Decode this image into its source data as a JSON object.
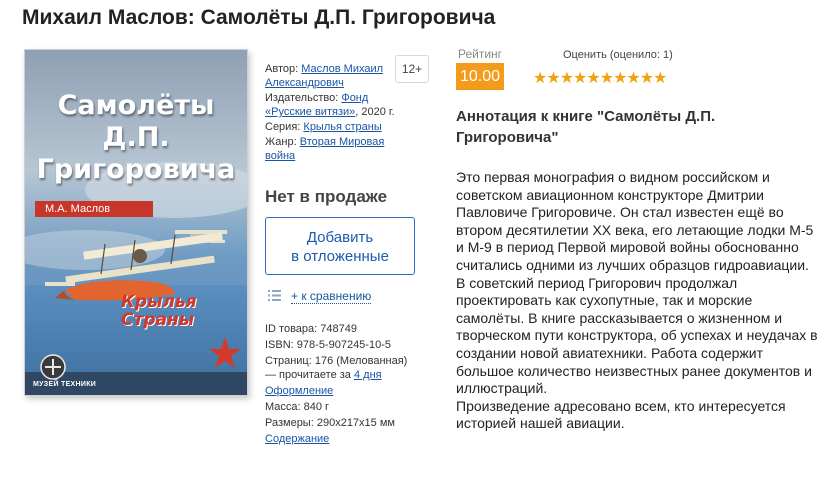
{
  "page_title": "Михаил Маслов: Самолёты Д.П. Григоровича",
  "cover": {
    "title_line1": "Самолёты",
    "title_line2": "Д.П. Григоровича",
    "author": "М.А. Маслов",
    "series_line1": "Крылья",
    "series_line2": "Страны",
    "publisher_mark": "МУЗЕЙ ТЕХНИКИ"
  },
  "age_rating": "12+",
  "meta": {
    "author_label": "Автор:",
    "author_value": "Маслов Михаил Александрович",
    "publisher_label": "Издательство:",
    "publisher_value": "Фонд «Русские витязи»",
    "publisher_year": ", 2020 г.",
    "series_label": "Серия:",
    "series_value": "Крылья страны",
    "genre_label": "Жанр:",
    "genre_value": "Вторая Мировая война"
  },
  "availability": "Нет в продаже",
  "add_button": {
    "line1": "Добавить",
    "line2": "в отложенные"
  },
  "compare_link": "+ к сравнению",
  "specs": {
    "id_label": "ID товара:",
    "id_value": "748749",
    "isbn_label": "ISBN:",
    "isbn_value": "978-5-907245-10-5",
    "pages_text": "Страниц: 176 (Мелованная)",
    "read_prefix": "— прочитаете за ",
    "read_link": "4 дня",
    "design_link": "Оформление",
    "weight_label": "Масса:",
    "weight_value": "840 г",
    "size_label": "Размеры:",
    "size_value": "290x217x15 мм",
    "contents_link": "Содержание"
  },
  "rating": {
    "label": "Рейтинг",
    "value": "10.00",
    "rated_text": "Оценить (оценило: 1)",
    "stars": "★★★★★★★★★★",
    "score": 10,
    "max": 10,
    "accent_color": "#f39b1a"
  },
  "annotation": {
    "title": "Аннотация к книге \"Самолёты Д.П. Григоровича\"",
    "paragraph1": "Это первая монография о видном российском и советском авиационном конструкторе Дмитрии Павловиче Григоровиче. Он стал известен ещё во втором десятилетии XX века, его летающие лодки М-5 и М-9 в период Первой мировой войны обоснованно считались одними из лучших образцов гидроавиации. В советский период Григорович продолжал проектировать как сухопутные, так и морские самолёты. В книге рассказывается о жизненном и творческом пути конструктора, об успехах и неудачах в создании новой авиатехники. Работа содержит большое количество неизвестных ранее документов и иллюстраций.",
    "paragraph2": "Произведение адресовано всем, кто интересуется историей нашей авиации."
  }
}
